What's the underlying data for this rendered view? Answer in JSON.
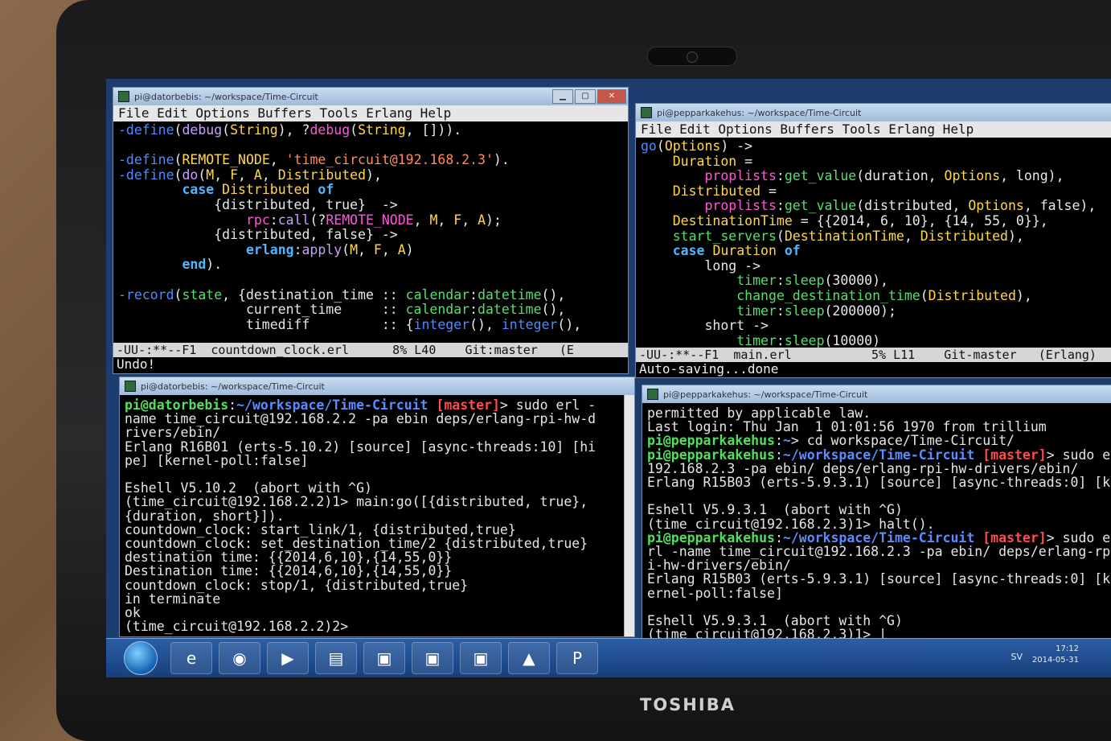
{
  "brand": "TOSHIBA",
  "windows": {
    "emacs_left": {
      "title": "pi@datorbebis: ~/workspace/Time-Circuit",
      "menu": "File Edit Options Buffers Tools Erlang Help",
      "modeline": "-UU-:**--F1  countdown_clock.erl      8% L40    Git:master   (E",
      "echo": "Undo!"
    },
    "emacs_right": {
      "title": "pi@pepparkakehus: ~/workspace/Time-Circuit",
      "menu": "File Edit Options Buffers Tools Erlang Help",
      "modeline": "-UU-:**--F1  main.erl           5% L11    Git-master   (Erlang)",
      "echo": "Auto-saving...done"
    },
    "term_left": {
      "title": "pi@datorbebis: ~/workspace/Time-Circuit"
    },
    "term_right": {
      "title": "pi@pepparkakehus: ~/workspace/Time-Circuit"
    }
  },
  "taskbar": {
    "language": "SV",
    "time": "17:12",
    "date": "2014-05-31"
  },
  "window_buttons": {
    "minimize": "▁",
    "maximize": "▢",
    "close": "✕"
  }
}
